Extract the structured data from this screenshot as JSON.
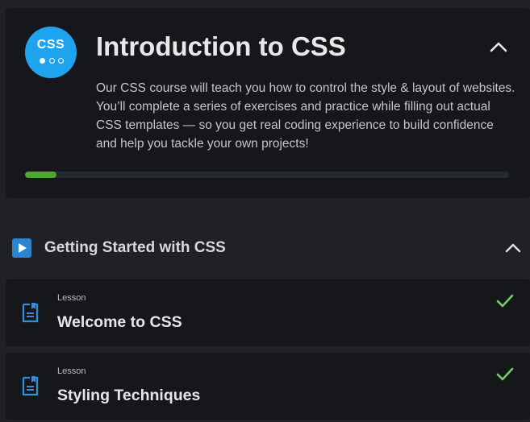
{
  "course": {
    "badge_label": "CSS",
    "title": "Introduction to CSS",
    "description": "Our CSS course will teach you how to control the style & layout of websites. You’ll complete a series of exercises and practice while filling out actual CSS templates — so you get real coding experience to build confidence and help you tackle your own projects!",
    "progress_fraction": 0.065,
    "collapse_icon": "chevron-up-icon"
  },
  "section": {
    "title": "Getting Started with CSS",
    "icon": "play-icon",
    "collapse_icon": "chevron-up-icon"
  },
  "lessons": [
    {
      "type": "Lesson",
      "title": "Welcome to CSS",
      "completed": true,
      "icon": "document-icon"
    },
    {
      "type": "Lesson",
      "title": "Styling Techniques",
      "completed": true,
      "icon": "document-icon"
    }
  ],
  "colors": {
    "badge": "#1ea3ee",
    "progress": "#4ca82d",
    "check": "#6fd160",
    "lesson_icon": "#2f8fe0",
    "background": "#1f2125",
    "card": "#15171a"
  }
}
